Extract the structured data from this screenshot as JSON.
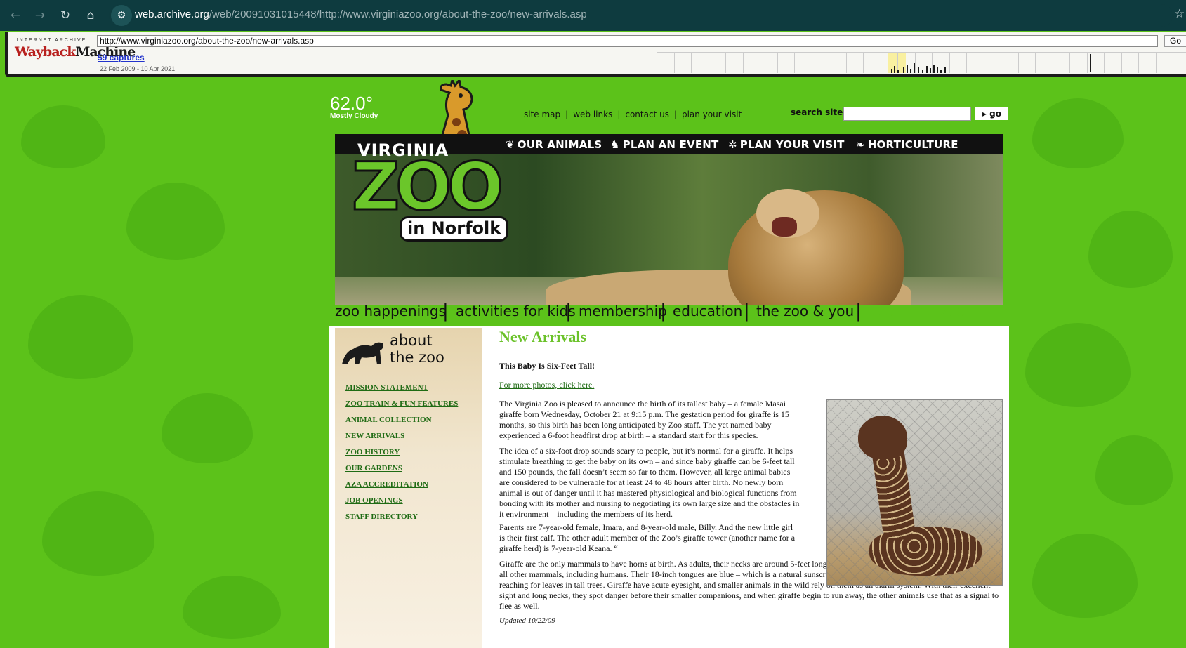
{
  "browser": {
    "url_host": "web.archive.org",
    "url_path": "/web/20091031015448/http://www.virginiazoo.org/about-the-zoo/new-arrivals.asp"
  },
  "wayback": {
    "logo_top": "INTERNET ARCHIVE",
    "logo_main_a": "Wayback",
    "logo_main_b": "Machine",
    "url_value": "http://www.virginiazoo.org/about-the-zoo/new-arrivals.asp",
    "go_label": "Go",
    "captures": "59 captures",
    "range": "22 Feb 2009 - 10 Apr 2021"
  },
  "weather": {
    "temp": "62.0°",
    "condition": "Mostly Cloudy"
  },
  "toplinks": [
    "site map",
    "web links",
    "contact us",
    "plan your visit"
  ],
  "search": {
    "label": "search site",
    "go": "go"
  },
  "logo": {
    "line1": "VIRGINIA",
    "line2": "ZOO",
    "line3": "in Norfolk"
  },
  "main_nav": [
    "OUR ANIMALS",
    "PLAN AN EVENT",
    "PLAN YOUR VISIT",
    "HORTICULTURE"
  ],
  "section_nav": [
    "zoo happenings",
    "activities for kids",
    "membership",
    "education",
    "the zoo & you",
    "about the zoo"
  ],
  "sidebar": {
    "title_line1": "about",
    "title_line2": "the zoo",
    "items": [
      "MISSION STATEMENT",
      "ZOO TRAIN & FUN FEATURES",
      "ANIMAL COLLECTION",
      "NEW ARRIVALS",
      "ZOO HISTORY",
      "OUR GARDENS",
      "AZA ACCREDITATION",
      "JOB OPENINGS",
      "STAFF DIRECTORY"
    ]
  },
  "article": {
    "title": "New Arrivals",
    "subtitle": "This Baby Is Six-Feet Tall!",
    "photos_link": "For more photos, click here.",
    "p1": "The Virginia Zoo is pleased to announce the birth of its tallest baby – a female Masai giraffe born Wednesday, October 21 at 9:15 p.m.  The gestation period for giraffe is 15 months, so this birth has been long anticipated by Zoo staff.  The yet named baby experienced a 6-foot headfirst drop at birth – a standard start for this species.",
    "p2": "The idea of a six-foot drop sounds scary to people, but it’s normal for a giraffe. It helps stimulate breathing to get the baby on its own – and since baby giraffe can be 6-feet tall and 150 pounds, the fall doesn’t seem so far to them. However, all large animal babies are considered to be vulnerable for at least 24 to 48 hours after birth. No newly born animal is out of danger until it has mastered physiological and biological functions from bonding with its mother and nursing to negotiating its own large size and the obstacles in it environment – including the members of its herd.",
    "p3": "Parents are 7-year-old female, Imara, and 8-year-old male, Billy. And the new little girl is their first calf. The other adult member of the Zoo’s giraffe tower (another name for a giraffe herd) is 7-year-old Keana. “",
    "p4": "Giraffe are the only mammals to have horns at birth. As adults, their necks are around 5-feet long, although they have only 7 vertebrae – the same as all other mammals, including humans. Their 18-inch tongues are blue – which is a natural sunscreen to protect them from getting burned when reaching for leaves in tall trees. Giraffe have acute eyesight, and smaller animals in the wild rely on them as an alarm system. With their excellent sight and long necks, they spot danger before their smaller companions, and when giraffe begin to run away, the other animals use that as a signal to flee as well.",
    "updated": "Updated 10/22/09"
  },
  "colors": {
    "background_green": "#5cc21a",
    "accent_green": "#6bc22a",
    "link_green": "#1f6b14",
    "chrome": "#0e3b3f"
  }
}
